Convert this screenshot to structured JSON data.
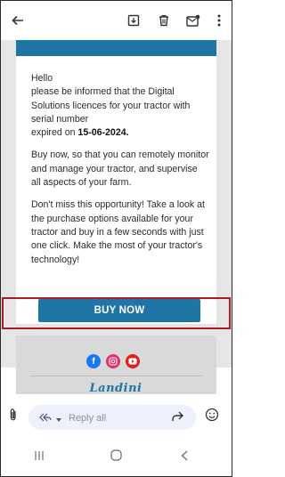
{
  "toolbar": {
    "back": "arrow-back-icon",
    "archive": "archive-icon",
    "delete": "trash-icon",
    "unread": "mark-unread-icon",
    "more": "more-vert-icon"
  },
  "email": {
    "greeting": "Hello",
    "line1": "please be informed that the Digital Solutions licences for your tractor with serial number",
    "expired_prefix": "expired on ",
    "expired_date": "15-06-2024.",
    "para2": "Buy now, so that you can remotely monitor and manage your tractor, and supervise all aspects of your farm.",
    "para3": "Don't miss this opportunity! Take a look at the purchase options available for your tractor and buy in a few seconds with just one click. Make the most of your tractor's technology!",
    "cta_label": "BUY NOW",
    "brand_logo": "Landini"
  },
  "social": [
    "facebook-icon",
    "instagram-icon",
    "youtube-icon"
  ],
  "reply": {
    "placeholder": "Reply all"
  },
  "colors": {
    "brand_blue": "#1f75a5",
    "highlight_red": "#a41f1f"
  }
}
